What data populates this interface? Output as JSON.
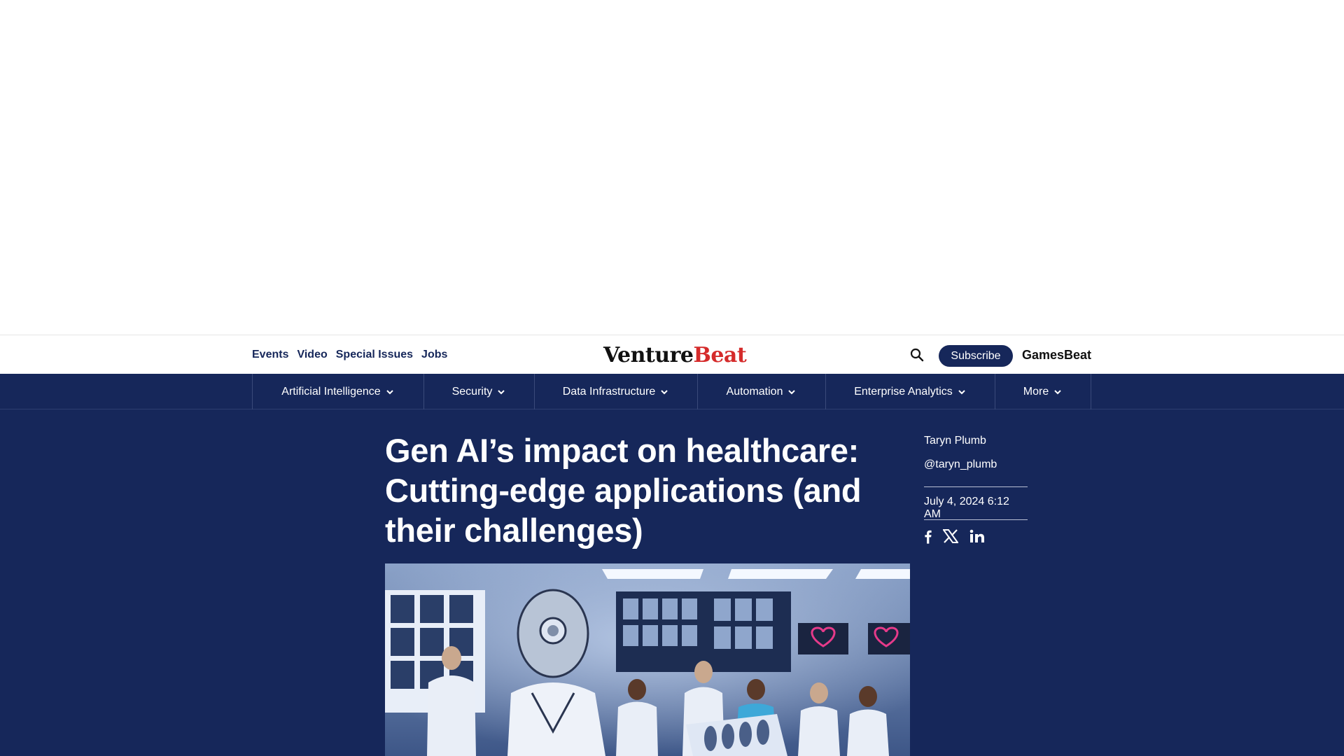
{
  "top_links": {
    "events": "Events",
    "video": "Video",
    "special_issues": "Special Issues",
    "jobs": "Jobs"
  },
  "logo": {
    "part1": "Venture",
    "part2": "Beat"
  },
  "header": {
    "subscribe": "Subscribe",
    "gamesbeat": "GamesBeat",
    "search_icon": "search-icon"
  },
  "categories": [
    {
      "label": "Artificial Intelligence"
    },
    {
      "label": "Security"
    },
    {
      "label": "Data Infrastructure"
    },
    {
      "label": "Automation"
    },
    {
      "label": "Enterprise Analytics"
    },
    {
      "label": "More"
    }
  ],
  "article": {
    "title": "Gen AI’s impact on healthcare: Cutting-edge applications (and their challenges)",
    "author": "Taryn Plumb",
    "handle": "@taryn_plumb",
    "date": "July 4, 2024 6:12 AM"
  },
  "social_icons": [
    "facebook-icon",
    "x-icon",
    "linkedin-icon"
  ],
  "colors": {
    "navy": "#16275a",
    "logo_red": "#d52b2b"
  }
}
